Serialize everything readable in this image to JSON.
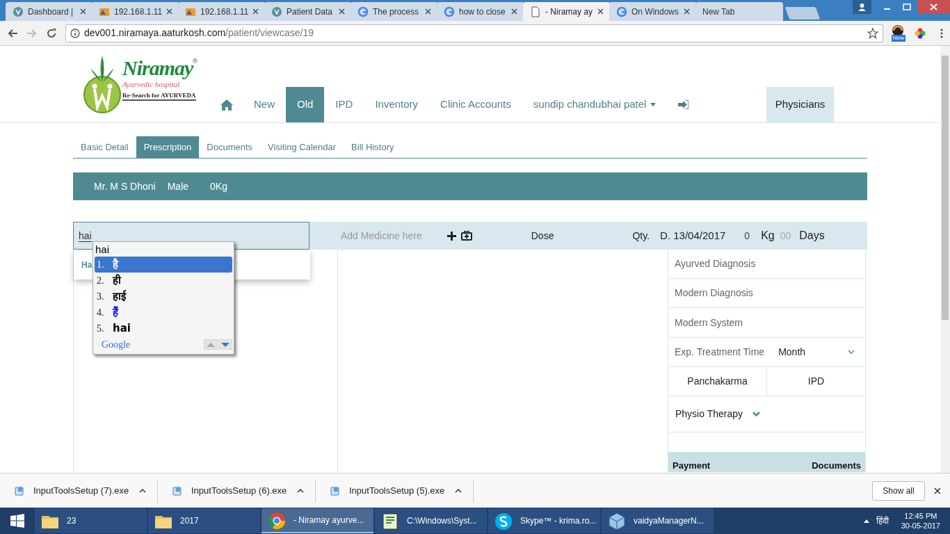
{
  "browser": {
    "tabs": [
      {
        "title": "Dashboard |",
        "selected": false
      },
      {
        "title": "192.168.1.11",
        "selected": false
      },
      {
        "title": "192.168.1.11",
        "selected": false
      },
      {
        "title": "Patient Data",
        "selected": false
      },
      {
        "title": "The process",
        "selected": false
      },
      {
        "title": "how to close",
        "selected": false
      },
      {
        "title": "- Niramay ay",
        "selected": true
      },
      {
        "title": "On Windows",
        "selected": false
      },
      {
        "title": "New Tab",
        "selected": false
      }
    ],
    "url_host": "dev001.niramaya.aaturkosh.com",
    "url_path": "/patient/viewcase/19",
    "extension_badge": "New"
  },
  "header": {
    "logo": {
      "name": "Niramay",
      "registered": "®",
      "subtitle": "Ayurvedic hospital",
      "tagline": "Re-Search for AYURVEDA"
    },
    "nav": [
      {
        "label": "New",
        "selected": false
      },
      {
        "label": "Old",
        "selected": true
      },
      {
        "label": "IPD",
        "selected": false
      },
      {
        "label": "Inventory",
        "selected": false
      },
      {
        "label": "Clinic Accounts",
        "selected": false
      },
      {
        "label": "sundip chandubhai patel",
        "selected": false,
        "dropdown": true
      }
    ],
    "physicians": "Physicians"
  },
  "subtabs": [
    {
      "label": "Basic Detail",
      "selected": false
    },
    {
      "label": "Prescription",
      "selected": true
    },
    {
      "label": "Documents",
      "selected": false
    },
    {
      "label": "Visiting Calendar",
      "selected": false
    },
    {
      "label": "Bill History",
      "selected": false
    }
  ],
  "patient": {
    "name": "Mr. M S Dhoni",
    "gender": "Male",
    "weight": "0Kg"
  },
  "medicine_row": {
    "search_value": "hai",
    "suggestion": "Ha",
    "medicine_placeholder": "Add Medicine here",
    "dose": "Dose",
    "qty": "Qty.",
    "date": "D. 13/04/2017",
    "weight_value": "0",
    "weight_unit": "Kg",
    "days_value": "00",
    "days_unit": "Days"
  },
  "ime": {
    "composition": "hai",
    "candidates": [
      {
        "number": "1.",
        "text": "है",
        "selected": true,
        "color": "#ffffff"
      },
      {
        "number": "2.",
        "text": "ही",
        "selected": false,
        "color": "#000000"
      },
      {
        "number": "3.",
        "text": "हाई",
        "selected": false,
        "color": "#000000"
      },
      {
        "number": "4.",
        "text": "हैं",
        "selected": false,
        "color": "#0000ff"
      },
      {
        "number": "5.",
        "text": "hai",
        "selected": false,
        "color": "#000000"
      }
    ],
    "brand": "Google"
  },
  "right_panel": {
    "fields": [
      "Ayurved Diagnosis",
      "Modern Diagnosis",
      "Modern System"
    ],
    "treatment_label": "Exp. Treatment Time",
    "treatment_value": "Month",
    "buttons": [
      "Panchakarma",
      "IPD"
    ],
    "physio": "Physio Therapy",
    "footer": [
      "Payment",
      "Documents"
    ]
  },
  "downloads": {
    "items": [
      "InputToolsSetup (7).exe",
      "InputToolsSetup (6).exe",
      "InputToolsSetup (5).exe"
    ],
    "show_all": "Show all"
  },
  "taskbar": {
    "items": [
      {
        "label": "23",
        "selected": false
      },
      {
        "label": "2017",
        "selected": false
      },
      {
        "label": "- Niramay ayurve...",
        "selected": true
      },
      {
        "label": "C:\\Windows\\Syst...",
        "selected": false
      },
      {
        "label": "Skype™ - krima.ro...",
        "selected": false
      },
      {
        "label": "vaidyaManagerN...",
        "selected": false
      }
    ],
    "language": "हिंदी",
    "time": "12:45 PM",
    "date": "30-05-2017"
  }
}
